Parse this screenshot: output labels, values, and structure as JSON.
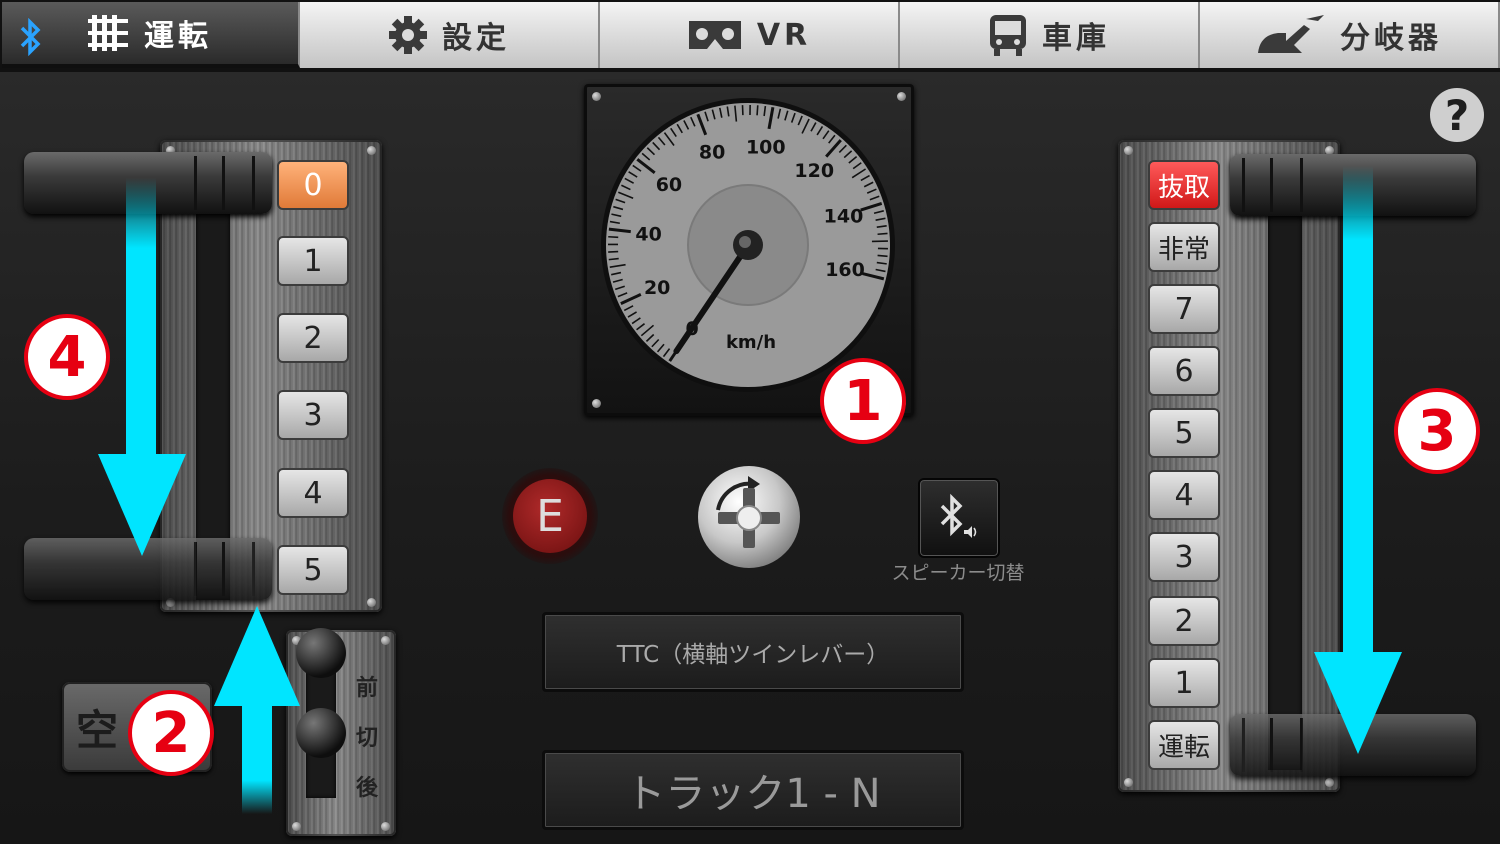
{
  "tabs": [
    {
      "label": "運転",
      "icon": "notch-icon",
      "active": true
    },
    {
      "label": "設定",
      "icon": "gear-icon",
      "active": false
    },
    {
      "label": "VR",
      "icon": "vr-goggles-icon",
      "active": false
    },
    {
      "label": "車庫",
      "icon": "train-icon",
      "active": false
    },
    {
      "label": "分岐器",
      "icon": "railway-switch-icon",
      "active": false
    }
  ],
  "power_notches": [
    "0",
    "1",
    "2",
    "3",
    "4",
    "5"
  ],
  "power_current": "0",
  "brake_notches": [
    "抜取",
    "非常",
    "7",
    "6",
    "5",
    "4",
    "3",
    "2",
    "1",
    "運転"
  ],
  "brake_current": "抜取",
  "speedometer": {
    "unit": "km/h",
    "ticks": [
      "0",
      "20",
      "40",
      "60",
      "80",
      "100",
      "120",
      "140",
      "160"
    ],
    "max": 160,
    "value": 0
  },
  "emergency_label": "E",
  "speaker_label": "スピーカー切替",
  "reverser_labels": [
    "前",
    "切",
    "後"
  ],
  "air_label": "空",
  "mode_display": "TTC（横軸ツインレバー）",
  "track_display": "トラック1 - N",
  "help_label": "?",
  "callouts": [
    "1",
    "2",
    "3",
    "4"
  ],
  "colors": {
    "accent_arrow": "#00e5ff",
    "callout_red": "#e60012",
    "notch_active": "#f08a44",
    "brake_active": "#e82020"
  }
}
